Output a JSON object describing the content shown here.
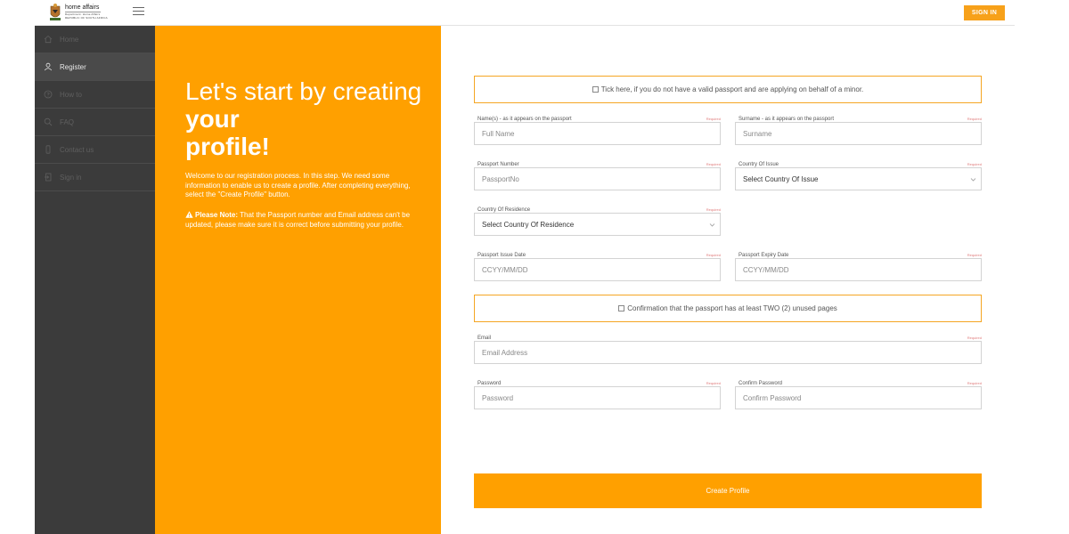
{
  "header": {
    "logo": {
      "line1": "home affairs",
      "line2": "Department:",
      "line3": "Home Affairs",
      "line4": "REPUBLIC OF SOUTH AFRICA"
    },
    "signin_label": "SIGN IN"
  },
  "sidebar": {
    "items": [
      {
        "label": "Home",
        "icon": "home-icon"
      },
      {
        "label": "Register",
        "icon": "user-icon"
      },
      {
        "label": "How to",
        "icon": "help-icon"
      },
      {
        "label": "FAQ",
        "icon": "search-icon"
      },
      {
        "label": "Contact us",
        "icon": "phone-icon"
      },
      {
        "label": "Sign in",
        "icon": "sign-in-icon"
      }
    ],
    "active_index": 1
  },
  "hero": {
    "title_part1": "Let's start by creating ",
    "title_bold1": "your",
    "title_bold2": "profile!",
    "intro": "Welcome to our registration process. In this step. We need some information to enable us to create a profile. After completing everything, select the \"Create Profile\" button.",
    "note_label": "Please Note:",
    "note_text": " That the Passport number and Email address can't be updated, please make sure it is correct before submitting your profile."
  },
  "form": {
    "minor_checkbox": "Tick here, if you do not have a valid passport and are applying on behalf of a minor.",
    "required_text": "Required",
    "names_label": "Name(s) - as it appears on the passport",
    "names_placeholder": "Full Name",
    "surname_label": "Surname - as it appears on the passport",
    "surname_placeholder": "Surname",
    "passport_label": "Passport Number",
    "passport_placeholder": "PassportNo",
    "country_issue_label": "Country Of Issue",
    "country_issue_value": "Select Country Of Issue",
    "country_res_label": "Country Of Residence",
    "country_res_value": "Select Country Of Residence",
    "issue_date_label": "Passport Issue Date",
    "issue_date_placeholder": "CCYY/MM/DD",
    "expiry_date_label": "Passport Expiry Date",
    "expiry_date_placeholder": "CCYY/MM/DD",
    "pages_checkbox": "Confirmation that the passport has at least TWO (2) unused pages",
    "email_label": "Email",
    "email_placeholder": "Email Address",
    "password_label": "Password",
    "password_placeholder": "Password",
    "confirm_label": "Confirm Password",
    "confirm_placeholder": "Confirm Password",
    "submit_label": "Create Profile"
  },
  "colors": {
    "accent": "#ffa000",
    "sidebar": "#3b3b3b",
    "checkbox_border": "#f5a623"
  }
}
